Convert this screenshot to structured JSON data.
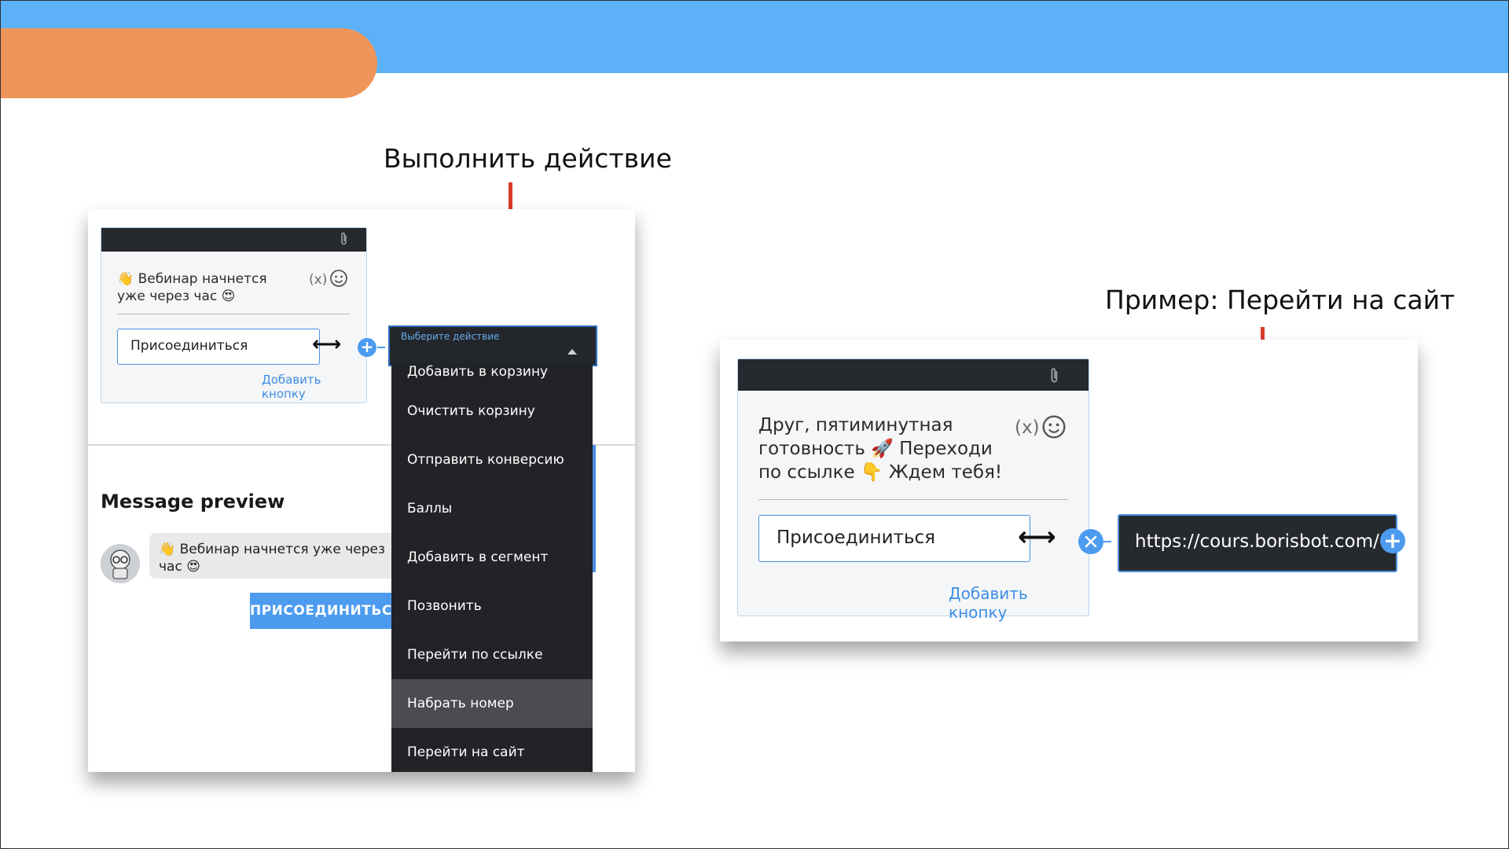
{
  "annotations": {
    "left_title": "Выполнить действие",
    "right_title": "Пример: Перейти на сайт"
  },
  "left_editor": {
    "message_text": "👋 Вебинар начнется уже через час 😍",
    "var_label": "(x)",
    "button_input_value": "Присоединиться",
    "add_button_link": "Добавить кнопку",
    "dropdown_label": "Выберите действие",
    "dropdown_items": [
      "Добавить в корзину",
      "Очистить корзину",
      "Отправить конверсию",
      "Баллы",
      "Добавить в сегмент",
      "Позвонить",
      "Перейти по ссылке",
      "Набрать номер",
      "Перейти на сайт"
    ],
    "highlighted_item": "Набрать номер",
    "preview_title": "Message preview",
    "preview_message": "👋 Вебинар начнется уже через час 😍",
    "preview_button": "ПРИСОЕДИНИТЬСЯ"
  },
  "right_editor": {
    "message_text": "Друг, пятиминутная готовность 🚀 Переходи по ссылке 👇 Ждем тебя!",
    "var_label": "(x)",
    "button_input_value": "Присоединиться",
    "add_button_link": "Добавить кнопку",
    "url_value": "https://cours.borisbot.com/"
  },
  "colors": {
    "top_bar": "#5cb1f9",
    "orange_tab": "#f0955a",
    "arrow": "#d93a2b",
    "accent": "#4c9bef"
  }
}
